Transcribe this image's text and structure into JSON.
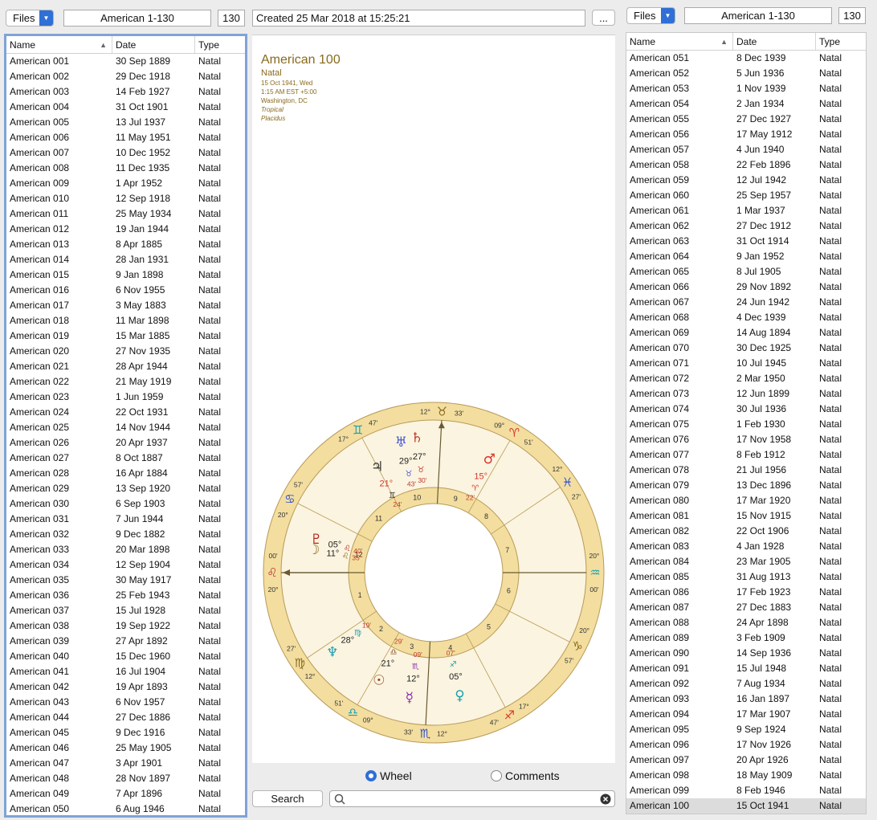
{
  "left": {
    "files_label": "Files",
    "title_value": "American 1-130",
    "count": "130",
    "columns": [
      "Name",
      "Date",
      "Type"
    ],
    "rows": [
      [
        "American 001",
        "30 Sep 1889",
        "Natal"
      ],
      [
        "American 002",
        "29 Dec 1918",
        "Natal"
      ],
      [
        "American 003",
        "14 Feb 1927",
        "Natal"
      ],
      [
        "American 004",
        "31 Oct 1901",
        "Natal"
      ],
      [
        "American 005",
        "13 Jul 1937",
        "Natal"
      ],
      [
        "American 006",
        "11 May 1951",
        "Natal"
      ],
      [
        "American 007",
        "10 Dec 1952",
        "Natal"
      ],
      [
        "American 008",
        "11 Dec 1935",
        "Natal"
      ],
      [
        "American 009",
        "1 Apr 1952",
        "Natal"
      ],
      [
        "American 010",
        "12 Sep 1918",
        "Natal"
      ],
      [
        "American 011",
        "25 May 1934",
        "Natal"
      ],
      [
        "American 012",
        "19 Jan 1944",
        "Natal"
      ],
      [
        "American 013",
        "8 Apr 1885",
        "Natal"
      ],
      [
        "American 014",
        "28 Jan 1931",
        "Natal"
      ],
      [
        "American 015",
        "9 Jan 1898",
        "Natal"
      ],
      [
        "American 016",
        "6 Nov 1955",
        "Natal"
      ],
      [
        "American 017",
        "3 May 1883",
        "Natal"
      ],
      [
        "American 018",
        "11 Mar 1898",
        "Natal"
      ],
      [
        "American 019",
        "15 Mar 1885",
        "Natal"
      ],
      [
        "American 020",
        "27 Nov 1935",
        "Natal"
      ],
      [
        "American 021",
        "28 Apr 1944",
        "Natal"
      ],
      [
        "American 022",
        "21 May 1919",
        "Natal"
      ],
      [
        "American 023",
        "1 Jun 1959",
        "Natal"
      ],
      [
        "American 024",
        "22 Oct 1931",
        "Natal"
      ],
      [
        "American 025",
        "14 Nov 1944",
        "Natal"
      ],
      [
        "American 026",
        "20 Apr 1937",
        "Natal"
      ],
      [
        "American 027",
        "8 Oct 1887",
        "Natal"
      ],
      [
        "American 028",
        "16 Apr 1884",
        "Natal"
      ],
      [
        "American 029",
        "13 Sep 1920",
        "Natal"
      ],
      [
        "American 030",
        "6 Sep 1903",
        "Natal"
      ],
      [
        "American 031",
        "7 Jun 1944",
        "Natal"
      ],
      [
        "American 032",
        "9 Dec 1882",
        "Natal"
      ],
      [
        "American 033",
        "20 Mar 1898",
        "Natal"
      ],
      [
        "American 034",
        "12 Sep 1904",
        "Natal"
      ],
      [
        "American 035",
        "30 May 1917",
        "Natal"
      ],
      [
        "American 036",
        "25 Feb 1943",
        "Natal"
      ],
      [
        "American 037",
        "15 Jul 1928",
        "Natal"
      ],
      [
        "American 038",
        "19 Sep 1922",
        "Natal"
      ],
      [
        "American 039",
        "27 Apr 1892",
        "Natal"
      ],
      [
        "American 040",
        "15 Dec 1960",
        "Natal"
      ],
      [
        "American 041",
        "16 Jul 1904",
        "Natal"
      ],
      [
        "American 042",
        "19 Apr 1893",
        "Natal"
      ],
      [
        "American 043",
        "6 Nov 1957",
        "Natal"
      ],
      [
        "American 044",
        "27 Dec 1886",
        "Natal"
      ],
      [
        "American 045",
        "9 Dec 1916",
        "Natal"
      ],
      [
        "American 046",
        "25 May 1905",
        "Natal"
      ],
      [
        "American 047",
        "3 Apr 1901",
        "Natal"
      ],
      [
        "American 048",
        "28 Nov 1897",
        "Natal"
      ],
      [
        "American 049",
        "7 Apr 1896",
        "Natal"
      ],
      [
        "American 050",
        "6 Aug 1946",
        "Natal"
      ]
    ]
  },
  "right": {
    "files_label": "Files",
    "title_value": "American 1-130",
    "count": "130",
    "columns": [
      "Name",
      "Date",
      "Type"
    ],
    "rows": [
      [
        "American 051",
        "8 Dec 1939",
        "Natal"
      ],
      [
        "American 052",
        "5 Jun 1936",
        "Natal"
      ],
      [
        "American 053",
        "1 Nov 1939",
        "Natal"
      ],
      [
        "American 054",
        "2 Jan 1934",
        "Natal"
      ],
      [
        "American 055",
        "27 Dec 1927",
        "Natal"
      ],
      [
        "American 056",
        "17 May 1912",
        "Natal"
      ],
      [
        "American 057",
        "4 Jun 1940",
        "Natal"
      ],
      [
        "American 058",
        "22 Feb 1896",
        "Natal"
      ],
      [
        "American 059",
        "12 Jul 1942",
        "Natal"
      ],
      [
        "American 060",
        "25 Sep 1957",
        "Natal"
      ],
      [
        "American 061",
        "1 Mar 1937",
        "Natal"
      ],
      [
        "American 062",
        "27 Dec 1912",
        "Natal"
      ],
      [
        "American 063",
        "31 Oct 1914",
        "Natal"
      ],
      [
        "American 064",
        "9 Jan 1952",
        "Natal"
      ],
      [
        "American 065",
        "8 Jul 1905",
        "Natal"
      ],
      [
        "American 066",
        "29 Nov 1892",
        "Natal"
      ],
      [
        "American 067",
        "24 Jun 1942",
        "Natal"
      ],
      [
        "American 068",
        "4 Dec 1939",
        "Natal"
      ],
      [
        "American 069",
        "14 Aug 1894",
        "Natal"
      ],
      [
        "American 070",
        "30 Dec 1925",
        "Natal"
      ],
      [
        "American 071",
        "10 Jul 1945",
        "Natal"
      ],
      [
        "American 072",
        "2 Mar 1950",
        "Natal"
      ],
      [
        "American 073",
        "12 Jun 1899",
        "Natal"
      ],
      [
        "American 074",
        "30 Jul 1936",
        "Natal"
      ],
      [
        "American 075",
        "1 Feb 1930",
        "Natal"
      ],
      [
        "American 076",
        "17 Nov 1958",
        "Natal"
      ],
      [
        "American 077",
        "8 Feb 1912",
        "Natal"
      ],
      [
        "American 078",
        "21 Jul 1956",
        "Natal"
      ],
      [
        "American 079",
        "13 Dec 1896",
        "Natal"
      ],
      [
        "American 080",
        "17 Mar 1920",
        "Natal"
      ],
      [
        "American 081",
        "15 Nov 1915",
        "Natal"
      ],
      [
        "American 082",
        "22 Oct 1906",
        "Natal"
      ],
      [
        "American 083",
        "4 Jan 1928",
        "Natal"
      ],
      [
        "American 084",
        "23 Mar 1905",
        "Natal"
      ],
      [
        "American 085",
        "31 Aug 1913",
        "Natal"
      ],
      [
        "American 086",
        "17 Feb 1923",
        "Natal"
      ],
      [
        "American 087",
        "27 Dec 1883",
        "Natal"
      ],
      [
        "American 088",
        "24 Apr 1898",
        "Natal"
      ],
      [
        "American 089",
        "3 Feb 1909",
        "Natal"
      ],
      [
        "American 090",
        "14 Sep 1936",
        "Natal"
      ],
      [
        "American 091",
        "15 Jul 1948",
        "Natal"
      ],
      [
        "American 092",
        "7 Aug 1934",
        "Natal"
      ],
      [
        "American 093",
        "16 Jan 1897",
        "Natal"
      ],
      [
        "American 094",
        "17 Mar 1907",
        "Natal"
      ],
      [
        "American 095",
        "9 Sep 1924",
        "Natal"
      ],
      [
        "American 096",
        "17 Nov 1926",
        "Natal"
      ],
      [
        "American 097",
        "20 Apr 1926",
        "Natal"
      ],
      [
        "American 098",
        "18 May 1909",
        "Natal"
      ],
      [
        "American 099",
        "8 Feb 1946",
        "Natal"
      ],
      [
        "American 100",
        "15 Oct 1941",
        "Natal"
      ]
    ],
    "selected_index": 49
  },
  "center": {
    "created_text": "Created 25 Mar 2018 at 15:25:21",
    "more_button": "...",
    "chart_name": "American 100",
    "chart_type": "Natal",
    "info_lines": [
      "15 Oct 1941, Wed",
      "1:15 AM EST +5:00",
      "Washington, DC",
      "Tropical",
      "Placidus"
    ],
    "view_options": [
      "Wheel",
      "Comments"
    ],
    "selected_view": "Wheel",
    "search_button": "Search",
    "search_value": ""
  },
  "wheel": {
    "colors": {
      "ring": "#f3deA0",
      "inner": "#fbf4e0",
      "line": "#b89a56"
    },
    "house_numbers": [
      "1",
      "2",
      "3",
      "4",
      "5",
      "6",
      "7",
      "8",
      "9",
      "10",
      "11",
      "12"
    ],
    "cusps": [
      {
        "deg": "20°",
        "min": "00'",
        "sign": "leo-icon",
        "glyph": "♌",
        "color": "#c0392b"
      },
      {
        "deg": "12°",
        "min": "27'",
        "sign": "virgo-icon",
        "glyph": "♍",
        "color": "#8a6a1e"
      },
      {
        "deg": "09°",
        "min": "51'",
        "sign": "libra-icon",
        "glyph": "♎",
        "color": "#1aa0b0"
      },
      {
        "deg": "12°",
        "min": "33'",
        "sign": "scorpio-icon",
        "glyph": "♏",
        "color": "#2c4fd0"
      },
      {
        "deg": "17°",
        "min": "47'",
        "sign": "sagittarius-icon",
        "glyph": "♐",
        "color": "#d9342b"
      },
      {
        "deg": "20°",
        "min": "57'",
        "sign": "capricorn-icon",
        "glyph": "♑",
        "color": "#8a6a1e"
      },
      {
        "deg": "20°",
        "min": "00'",
        "sign": "aquarius-icon",
        "glyph": "♒",
        "color": "#1aa0b0"
      },
      {
        "deg": "12°",
        "min": "27'",
        "sign": "pisces-icon",
        "glyph": "♓",
        "color": "#2c4fd0"
      },
      {
        "deg": "09°",
        "min": "51'",
        "sign": "aries-icon",
        "glyph": "♈",
        "color": "#d9342b"
      },
      {
        "deg": "12°",
        "min": "33'",
        "sign": "taurus-icon",
        "glyph": "♉",
        "color": "#8a6a1e"
      },
      {
        "deg": "17°",
        "min": "47'",
        "sign": "gemini-icon",
        "glyph": "♊",
        "color": "#1aa0b0"
      },
      {
        "deg": "20°",
        "min": "57'",
        "sign": "cancer-icon",
        "glyph": "♋",
        "color": "#2c4fd0"
      }
    ],
    "planets": [
      {
        "name": "uranus-icon",
        "glyph": "♅",
        "color": "#4a55d8",
        "deg": "29°",
        "min": "43'",
        "sign": "♉"
      },
      {
        "name": "saturn-icon",
        "glyph": "♄",
        "color": "#c0392b",
        "deg": "27°",
        "min": "30'",
        "sign": "♉"
      },
      {
        "name": "jupiter-icon",
        "glyph": "♃",
        "color": "#333",
        "deg": "21°",
        "min": "24'",
        "sign": "♊"
      },
      {
        "name": "mars-icon",
        "glyph": "♂",
        "color": "#d9342b",
        "deg": "15°",
        "min": "22'",
        "sign": "♈"
      },
      {
        "name": "pluto-icon",
        "glyph": "♇",
        "color": "#b0281e",
        "deg": "05°",
        "min": "40'",
        "sign": "♌"
      },
      {
        "name": "moon-icon",
        "glyph": "☽",
        "color": "#8a6a1e",
        "deg": "11°",
        "min": "35'",
        "sign": "♌"
      },
      {
        "name": "neptune-icon",
        "glyph": "♆",
        "color": "#1aa0b0",
        "deg": "28°",
        "min": "19'",
        "sign": "♍"
      },
      {
        "name": "sun-icon",
        "glyph": "☉",
        "color": "#8a4a1e",
        "deg": "21°",
        "min": "29'",
        "sign": "♎"
      },
      {
        "name": "mercury-icon",
        "glyph": "☿",
        "color": "#8a2ab0",
        "deg": "12°",
        "min": "09'",
        "sign": "♏"
      },
      {
        "name": "venus-icon",
        "glyph": "♀",
        "color": "#1aa0b0",
        "deg": "05°",
        "min": "07'",
        "sign": "♐"
      }
    ]
  }
}
